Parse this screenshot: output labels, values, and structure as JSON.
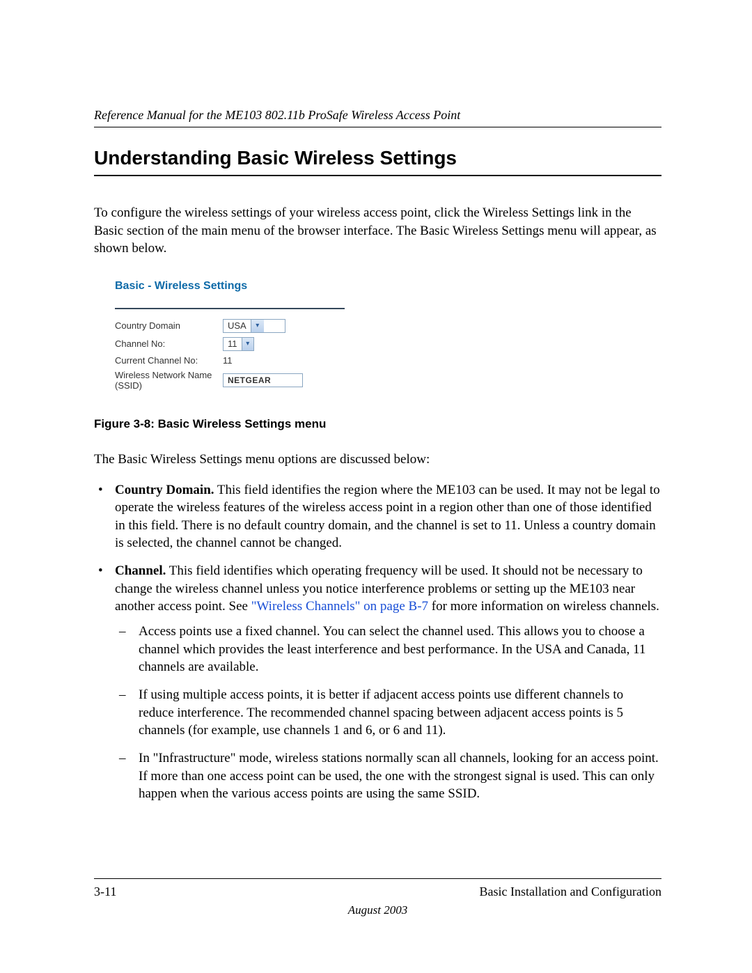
{
  "header": {
    "running": "Reference Manual for the ME103 802.11b ProSafe Wireless Access Point"
  },
  "title": "Understanding Basic Wireless Settings",
  "intro": "To configure the wireless settings of your wireless access point, click the Wireless Settings link in the Basic section of the main menu of the browser interface. The Basic Wireless Settings menu will appear, as shown below.",
  "figure": {
    "panel_title": "Basic - Wireless Settings",
    "rows": {
      "country_domain": {
        "label": "Country Domain",
        "value": "USA"
      },
      "channel_no": {
        "label": "Channel No:",
        "value": "11"
      },
      "current_channel": {
        "label": "Current Channel No:",
        "value": "11"
      },
      "ssid": {
        "label": "Wireless Network Name (SSID)",
        "value": "NETGEAR"
      }
    },
    "caption": "Figure 3-8: Basic Wireless Settings menu"
  },
  "after_figure": "The Basic Wireless Settings menu options are discussed below:",
  "bullets": {
    "country": {
      "lead": "Country Domain.",
      "text": " This field identifies the region where the ME103 can be used. It may not be legal to operate the wireless features of the wireless access point in a region other than one of those identified in this field. There is no default country domain, and the channel is set to 11. Unless a country domain is selected, the channel cannot be changed."
    },
    "channel": {
      "lead": "Channel.",
      "text_before_link": " This field identifies which operating frequency will be used. It should not be necessary to change the wireless channel unless you notice interference problems or setting up the ME103 near another access point. See ",
      "link": "\"Wireless Channels\" on page B-7",
      "text_after_link": " for more information on wireless channels.",
      "subs": {
        "a": "Access points use a fixed channel. You can select the channel used. This allows you to choose a channel which provides the least interference and best performance. In the USA and Canada, 11 channels are available.",
        "b": "If using multiple access points, it is better if adjacent access points use different channels to reduce interference. The recommended channel spacing between adjacent access points is 5 channels (for example, use channels 1 and 6, or 6 and 11).",
        "c": "In \"Infrastructure\" mode, wireless stations normally scan all channels, looking for an access point. If more than one access point can be used, the one with the strongest signal is used. This can only happen when the various access points are using the same SSID."
      }
    }
  },
  "footer": {
    "page": "3-11",
    "section": "Basic Installation and Configuration",
    "date": "August 2003"
  }
}
